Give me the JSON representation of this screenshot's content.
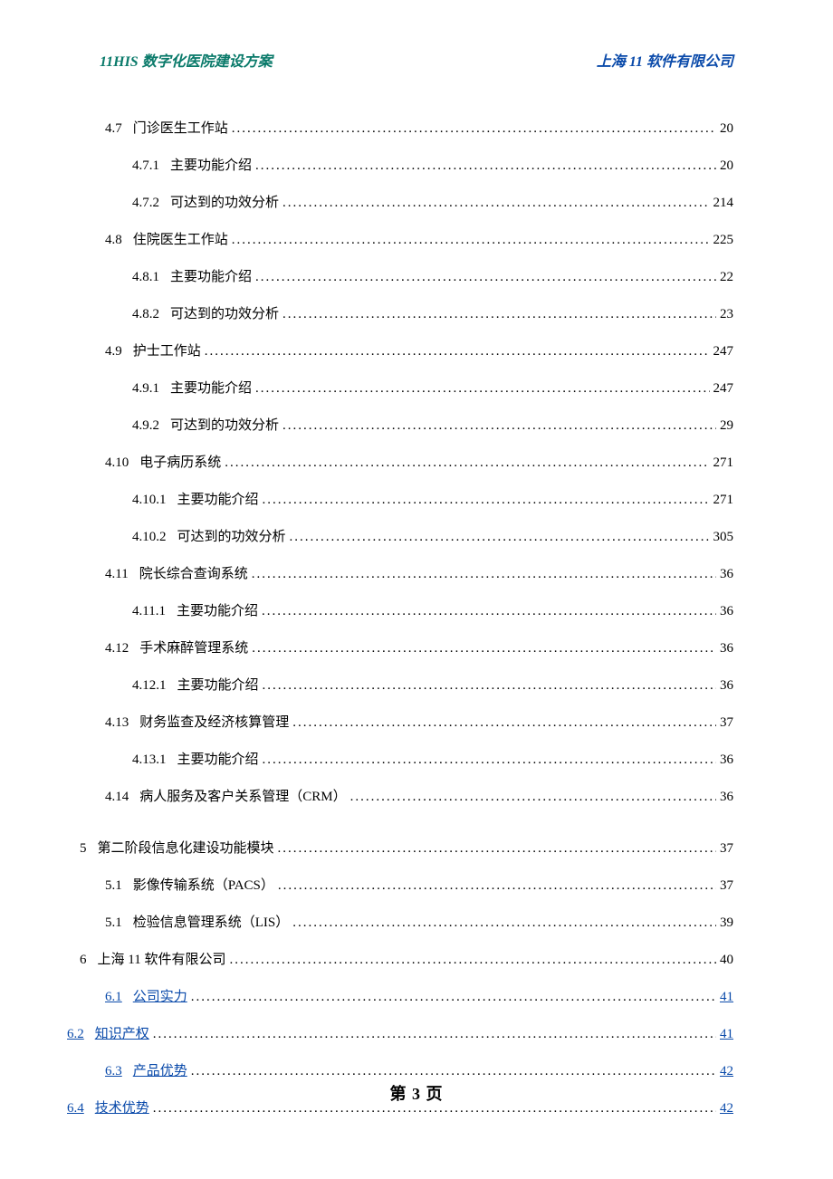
{
  "header": {
    "left": "11HIS 数字化医院建设方案",
    "right": "上海 11 软件有限公司"
  },
  "toc": [
    {
      "level": "lv2",
      "num": "4.7",
      "txt": "门诊医生工作站",
      "pg": "20",
      "link": false
    },
    {
      "level": "lv3",
      "num": "4.7.1",
      "txt": "主要功能介绍",
      "pg": "20",
      "link": false
    },
    {
      "level": "lv3",
      "num": "4.7.2",
      "txt": "可达到的功效分析",
      "pg": "214",
      "link": false
    },
    {
      "level": "lv2",
      "num": "4.8",
      "txt": "住院医生工作站",
      "pg": "225",
      "link": false
    },
    {
      "level": "lv3",
      "num": "4.8.1",
      "txt": "主要功能介绍",
      "pg": "22",
      "link": false
    },
    {
      "level": "lv3",
      "num": "4.8.2",
      "txt": "可达到的功效分析",
      "pg": "23",
      "link": false
    },
    {
      "level": "lv2",
      "num": "4.9",
      "txt": "护士工作站",
      "pg": "247",
      "link": false
    },
    {
      "level": "lv3",
      "num": "4.9.1",
      "txt": "主要功能介绍",
      "pg": "247",
      "link": false
    },
    {
      "level": "lv3",
      "num": "4.9.2",
      "txt": "可达到的功效分析",
      "pg": "29",
      "link": false
    },
    {
      "level": "lv2",
      "num": "4.10",
      "txt": "电子病历系统",
      "pg": "271",
      "link": false
    },
    {
      "level": "lv3",
      "num": "4.10.1",
      "txt": "主要功能介绍",
      "pg": "271",
      "link": false
    },
    {
      "level": "lv3",
      "num": "4.10.2",
      "txt": "可达到的功效分析",
      "pg": "305",
      "link": false
    },
    {
      "level": "lv2",
      "num": "4.11",
      "txt": "院长综合查询系统",
      "pg": "36",
      "link": false
    },
    {
      "level": "lv3",
      "num": "4.11.1",
      "txt": "主要功能介绍",
      "pg": "36",
      "link": false
    },
    {
      "level": "lv2",
      "num": "4.12",
      "txt": "手术麻醉管理系统",
      "pg": "36",
      "link": false
    },
    {
      "level": "lv3",
      "num": "4.12.1",
      "txt": "主要功能介绍",
      "pg": "36",
      "link": false
    },
    {
      "level": "lv2",
      "num": "4.13",
      "txt": "财务监查及经济核算管理",
      "pg": "37",
      "link": false
    },
    {
      "level": "lv3",
      "num": "4.13.1",
      "txt": "主要功能介绍",
      "pg": "36",
      "link": false
    },
    {
      "level": "lv2",
      "num": "4.14",
      "txt": "病人服务及客户关系管理（CRM）",
      "pg": "36",
      "link": false
    },
    {
      "level": "spacer"
    },
    {
      "level": "lv1",
      "num": "5",
      "txt": "第二阶段信息化建设功能模块",
      "pg": "37",
      "link": false
    },
    {
      "level": "lv2",
      "num": "5.1",
      "txt": "影像传输系统（PACS）",
      "pg": "37",
      "link": false
    },
    {
      "level": "lv2",
      "num": "5.1",
      "txt": "检验信息管理系统（LIS）",
      "pg": "39",
      "link": false
    },
    {
      "level": "lv1",
      "num": "6",
      "txt": "上海 11 软件有限公司",
      "pg": "40",
      "link": false
    },
    {
      "level": "lv2",
      "num": "6.1",
      "txt": "公司实力",
      "pg": "41",
      "link": true
    },
    {
      "level": "lv1-alt",
      "num": "6.2",
      "txt": "知识产权",
      "pg": "41",
      "link": true
    },
    {
      "level": "lv2",
      "num": "6.3",
      "txt": "产品优势",
      "pg": "42",
      "link": true
    },
    {
      "level": "lv1-alt",
      "num": "6.4",
      "txt": "技术优势",
      "pg": "42",
      "link": true
    }
  ],
  "footer": "第 3 页"
}
